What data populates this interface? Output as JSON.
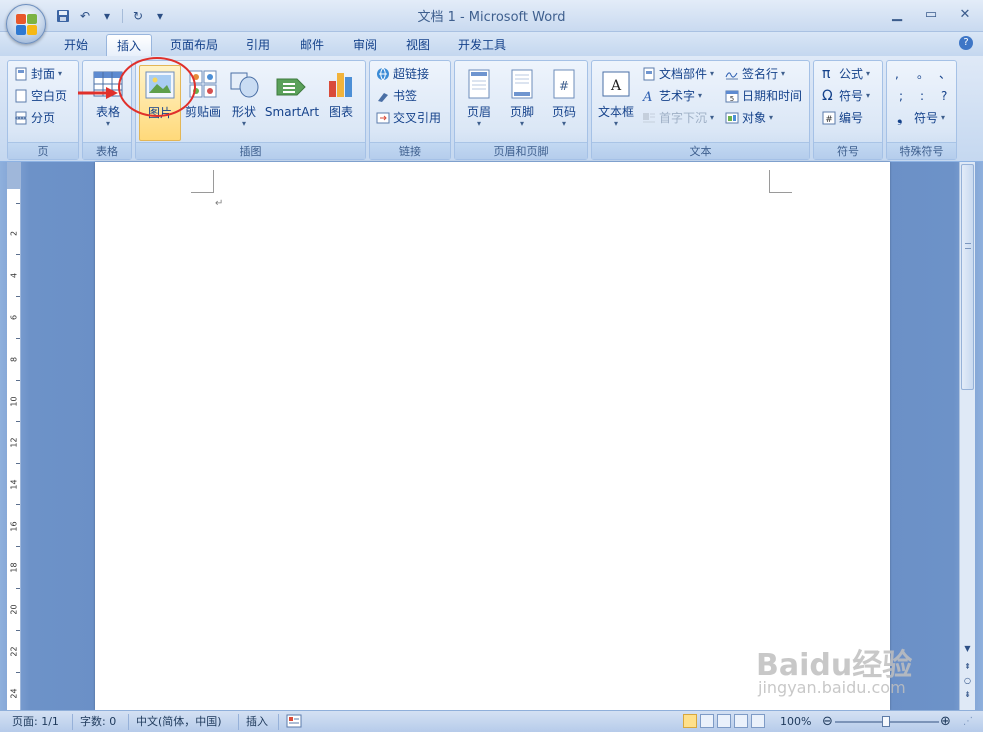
{
  "window": {
    "title": "文档 1 - Microsoft Word",
    "controls": [
      "minimize",
      "maximize",
      "close"
    ]
  },
  "quick_access": {
    "items": [
      "save-icon",
      "undo-icon",
      "redo-icon",
      "customize-icon"
    ]
  },
  "tabs": [
    {
      "label": "开始"
    },
    {
      "label": "插入",
      "active": true
    },
    {
      "label": "页面布局"
    },
    {
      "label": "引用"
    },
    {
      "label": "邮件"
    },
    {
      "label": "审阅"
    },
    {
      "label": "视图"
    },
    {
      "label": "开发工具"
    }
  ],
  "ribbon": {
    "pages": {
      "label": "页",
      "items": [
        "封面",
        "空白页",
        "分页"
      ]
    },
    "tables": {
      "label": "表格",
      "table_btn": "表格"
    },
    "illustrations": {
      "label": "插图",
      "items": [
        "图片",
        "剪贴画",
        "形状",
        "SmartArt",
        "图表"
      ]
    },
    "links": {
      "label": "链接",
      "items": [
        "超链接",
        "书签",
        "交叉引用"
      ]
    },
    "header_footer": {
      "label": "页眉和页脚",
      "items": [
        "页眉",
        "页脚",
        "页码"
      ]
    },
    "text": {
      "label": "文本",
      "textbox": "文本框",
      "col1": [
        "文档部件",
        "艺术字",
        "首字下沉"
      ],
      "col2": [
        "签名行",
        "日期和时间",
        "对象"
      ]
    },
    "symbols": {
      "label": "符号",
      "items": [
        "公式",
        "符号",
        "编号"
      ]
    },
    "special": {
      "label": "特殊符号",
      "chars": [
        ",",
        "。",
        "、",
        ";",
        ":",
        "?"
      ],
      "more": "符号"
    }
  },
  "ruler": {
    "labels": [
      "2",
      "4",
      "6",
      "8",
      "10",
      "12",
      "14",
      "16",
      "18",
      "20",
      "22",
      "24"
    ]
  },
  "document": {
    "paragraph_mark": "↵"
  },
  "status": {
    "page": "页面: 1/1",
    "words": "字数: 0",
    "language": "中文(简体，中国)",
    "mode": "插入",
    "zoom": "100%",
    "zoom_value": 1.0
  },
  "watermark": {
    "brand": "Baidu经验",
    "url": "jingyan.baidu.com"
  },
  "colors": {
    "accent": "#15428b",
    "ribbon_bg": "#dbe7f6",
    "annotation": "#e0302b",
    "selected": "#ffd97a"
  }
}
